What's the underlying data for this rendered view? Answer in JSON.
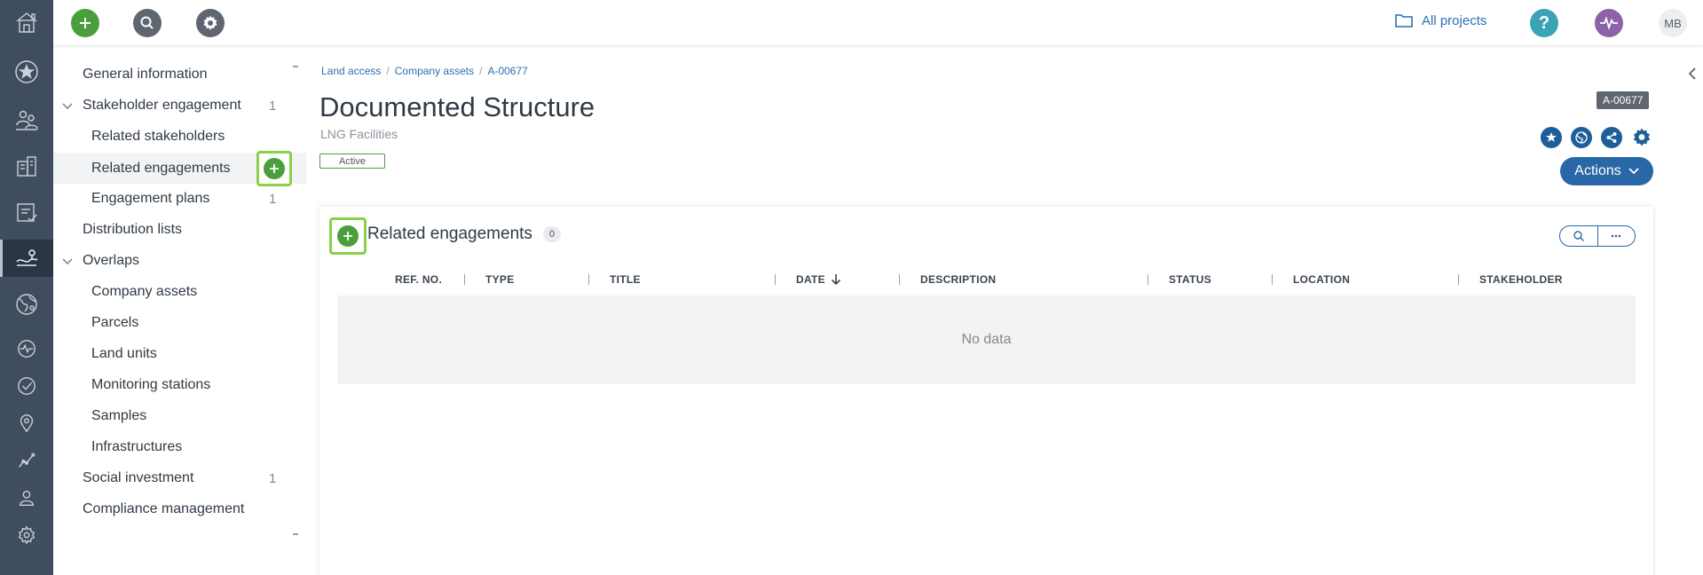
{
  "topbar": {
    "projects_label": "All projects",
    "help_label": "?",
    "avatar_initials": "MB"
  },
  "sidenav": {
    "items": [
      {
        "label": "General information",
        "count": ""
      },
      {
        "label": "Stakeholder engagement",
        "count": "1"
      },
      {
        "label": "Related stakeholders",
        "count": ""
      },
      {
        "label": "Related engagements",
        "count": ""
      },
      {
        "label": "Engagement plans",
        "count": "1"
      },
      {
        "label": "Distribution lists",
        "count": ""
      },
      {
        "label": "Overlaps",
        "count": ""
      },
      {
        "label": "Company assets",
        "count": ""
      },
      {
        "label": "Parcels",
        "count": ""
      },
      {
        "label": "Land units",
        "count": ""
      },
      {
        "label": "Monitoring stations",
        "count": ""
      },
      {
        "label": "Samples",
        "count": ""
      },
      {
        "label": "Infrastructures",
        "count": ""
      },
      {
        "label": "Social investment",
        "count": "1"
      },
      {
        "label": "Compliance management",
        "count": ""
      }
    ]
  },
  "breadcrumb": [
    "Land access",
    "Company assets",
    "A-00677"
  ],
  "record": {
    "title": "Documented Structure",
    "subtitle": "LNG Facilities",
    "status": "Active",
    "id": "A-00677",
    "actions_label": "Actions"
  },
  "panel": {
    "title": "Related engagements",
    "count": "0",
    "columns": [
      "REF. NO.",
      "TYPE",
      "TITLE",
      "DATE",
      "DESCRIPTION",
      "STATUS",
      "LOCATION",
      "STAKEHOLDER"
    ],
    "sorted_column": "DATE",
    "sort_direction": "descending",
    "empty_text": "No data"
  },
  "colors": {
    "rail": "#3f4d5e",
    "accent_blue": "#2a67a6",
    "add_green": "#4a9e3d",
    "highlight_green": "#8bd147"
  }
}
